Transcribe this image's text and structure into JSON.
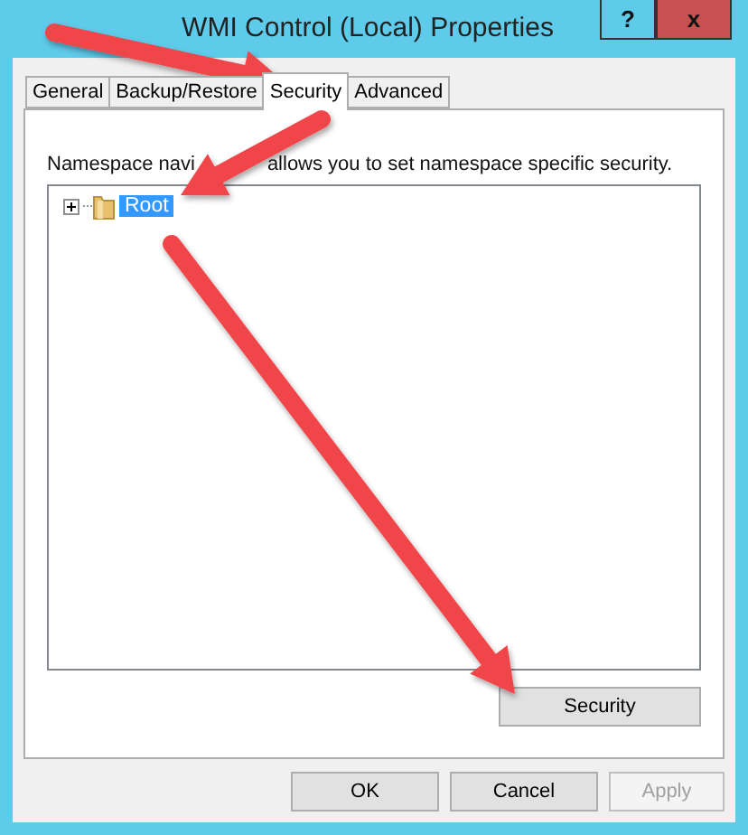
{
  "window": {
    "title": "WMI Control (Local) Properties",
    "help_button": "?",
    "close_button": "x"
  },
  "tabs": [
    {
      "label": "General",
      "selected": false
    },
    {
      "label": "Backup/Restore",
      "selected": false
    },
    {
      "label": "Security",
      "selected": true
    },
    {
      "label": "Advanced",
      "selected": false
    }
  ],
  "description": [
    "Namespace navi",
    "allows you to set namespace specific security."
  ],
  "tree": [
    {
      "label": "Root",
      "selected": true,
      "expanded": false
    }
  ],
  "security_button": "Security",
  "buttons": [
    {
      "label": "OK",
      "disabled": false
    },
    {
      "label": "Cancel",
      "disabled": false
    },
    {
      "label": "Apply",
      "disabled": true
    }
  ]
}
